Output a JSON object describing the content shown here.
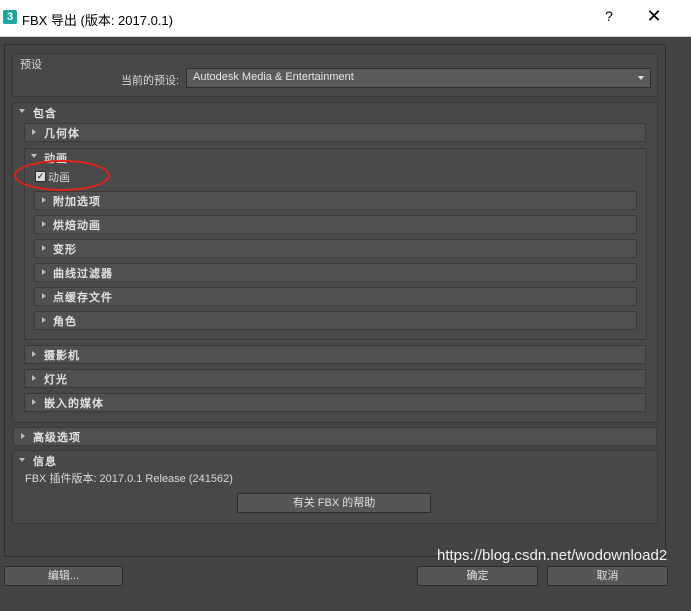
{
  "window": {
    "app_icon": "3",
    "title": "FBX 导出 (版本: 2017.0.1)",
    "help_label": "?",
    "close_label": "✕"
  },
  "preset": {
    "header": "预设",
    "current_label": "当前的预设:",
    "current_value": "Autodesk Media & Entertainment"
  },
  "include": {
    "header": "包含",
    "geometry": "几何体",
    "animation": {
      "header": "动画",
      "checkbox_label": "动画",
      "checked": true,
      "subsections": [
        "附加选项",
        "烘焙动画",
        "变形",
        "曲线过滤器",
        "点缓存文件",
        "角色"
      ]
    },
    "camera": "摄影机",
    "lights": "灯光",
    "embed_media": "嵌入的媒体"
  },
  "advanced": {
    "header": "高级选项"
  },
  "info": {
    "header": "信息",
    "plugin_version": "FBX 插件版本: 2017.0.1 Release (241562)",
    "help_button": "有关 FBX 的帮助"
  },
  "footer": {
    "edit_button": "编辑...",
    "ok_button": "确定",
    "cancel_button": "取消"
  },
  "watermark": "https://blog.csdn.net/wodownload2",
  "annotation_color": "#e2231a"
}
